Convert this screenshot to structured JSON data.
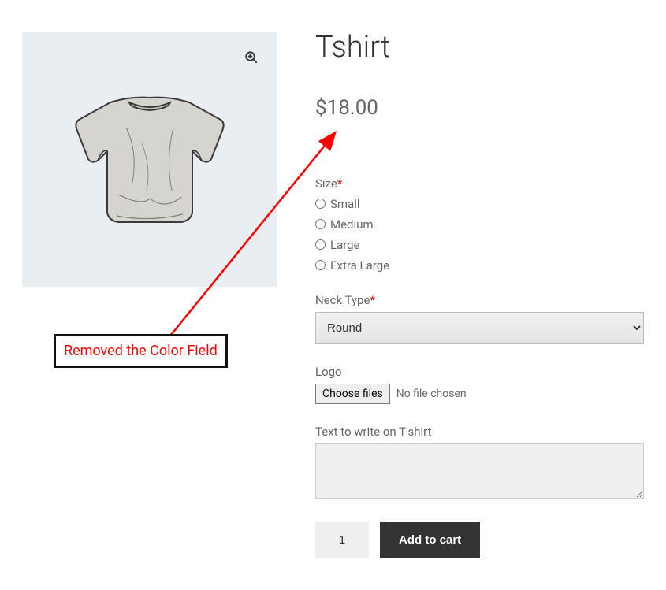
{
  "product": {
    "title": "Tshirt",
    "price": "$18.00"
  },
  "annotation": {
    "text": "Removed the Color Field"
  },
  "fields": {
    "size": {
      "label": "Size",
      "options": [
        "Small",
        "Medium",
        "Large",
        "Extra Large"
      ]
    },
    "neck": {
      "label": "Neck Type",
      "selected": "Round"
    },
    "logo": {
      "label": "Logo",
      "button": "Choose files",
      "status": "No file chosen"
    },
    "customText": {
      "label": "Text to write on T-shirt"
    }
  },
  "cart": {
    "quantity": "1",
    "addButton": "Add to cart"
  },
  "icons": {
    "zoom": "search-plus"
  }
}
